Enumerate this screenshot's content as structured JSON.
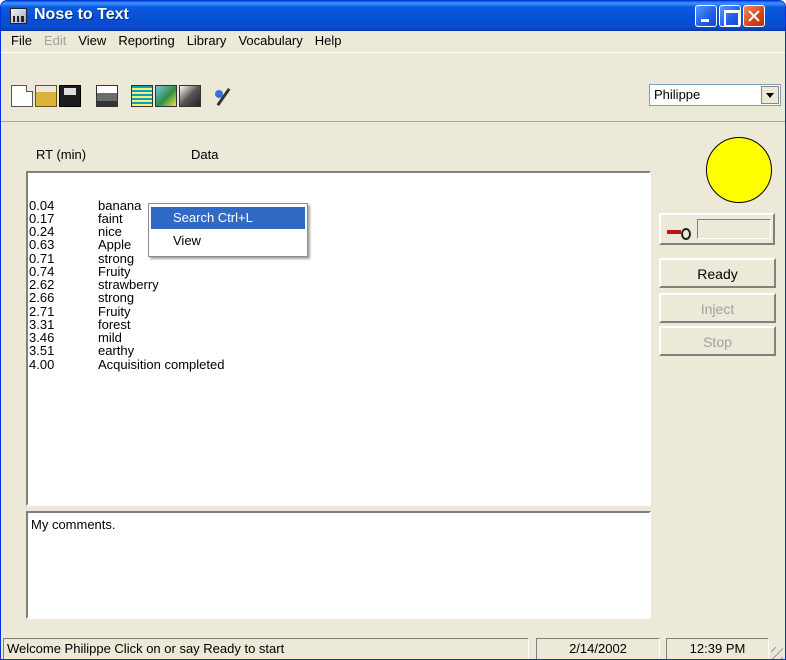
{
  "window": {
    "title": "Nose to Text"
  },
  "menu": [
    {
      "label": "File",
      "disabled": false
    },
    {
      "label": "Edit",
      "disabled": true
    },
    {
      "label": "View",
      "disabled": false
    },
    {
      "label": "Reporting",
      "disabled": false
    },
    {
      "label": "Library",
      "disabled": false
    },
    {
      "label": "Vocabulary",
      "disabled": false
    },
    {
      "label": "Help",
      "disabled": false
    }
  ],
  "toolbar": {
    "icons": [
      "new-icon",
      "open-icon",
      "save-icon",
      "print-icon",
      "list-icon",
      "picture-icon",
      "image-icon",
      "wand-icon"
    ],
    "user": "Philippe"
  },
  "data_table": {
    "headers": [
      "RT (min)",
      "Data"
    ],
    "rows": [
      [
        "0.04",
        "banana"
      ],
      [
        "0.17",
        "faint"
      ],
      [
        "0.24",
        "nice"
      ],
      [
        "0.63",
        "Apple"
      ],
      [
        "0.71",
        "strong"
      ],
      [
        "0.74",
        "Fruity"
      ],
      [
        "2.62",
        "strawberry"
      ],
      [
        "2.66",
        "strong"
      ],
      [
        "2.71",
        "Fruity"
      ],
      [
        "3.31",
        "forest"
      ],
      [
        "3.46",
        "mild"
      ],
      [
        "3.51",
        "earthy"
      ],
      [
        "4.00",
        "Acquisition completed"
      ]
    ]
  },
  "context_menu": {
    "items": [
      {
        "label": "Search  Ctrl+L",
        "highlighted": true
      },
      {
        "label": "View",
        "highlighted": false
      }
    ]
  },
  "comments": "My comments.",
  "side_panel": {
    "indicator_color": "#ffff00",
    "buttons": [
      {
        "label": "Ready",
        "disabled": false
      },
      {
        "label": "Inject",
        "disabled": true
      },
      {
        "label": "Stop",
        "disabled": true
      }
    ]
  },
  "status": {
    "message": "Welcome Philippe Click on or say Ready to start",
    "date": "2/14/2002",
    "time": "12:39 PM"
  }
}
